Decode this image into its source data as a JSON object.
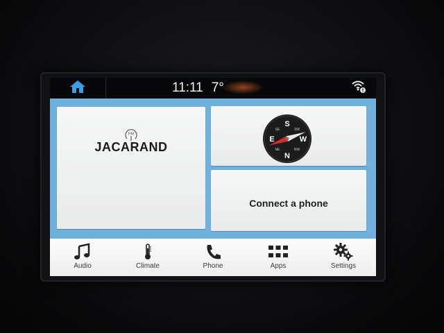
{
  "status_bar": {
    "time": "11:11",
    "temperature": "7°",
    "home_icon": "home-icon",
    "wifi_icon": "wifi-hotspot-icon"
  },
  "tiles": {
    "audio": {
      "band": "FM",
      "station": "JACARAND"
    },
    "navigation": {
      "compass_letters": [
        "S",
        "E",
        "W",
        "N"
      ],
      "compass_ticks": [
        "SE",
        "SW",
        "NE",
        "NW"
      ]
    },
    "phone": {
      "label": "Connect a phone"
    }
  },
  "dock": {
    "items": [
      {
        "label": "Audio",
        "icon": "music-note-icon"
      },
      {
        "label": "Climate",
        "icon": "thermometer-icon"
      },
      {
        "label": "Phone",
        "icon": "phone-icon"
      },
      {
        "label": "Apps",
        "icon": "apps-grid-icon"
      },
      {
        "label": "Settings",
        "icon": "gears-icon"
      }
    ]
  },
  "colors": {
    "content_background": "#6fb1dc",
    "accent_blue": "#3a9ee0",
    "tile": "#f2f3f3",
    "compass_needle_red": "#d22b2b"
  }
}
